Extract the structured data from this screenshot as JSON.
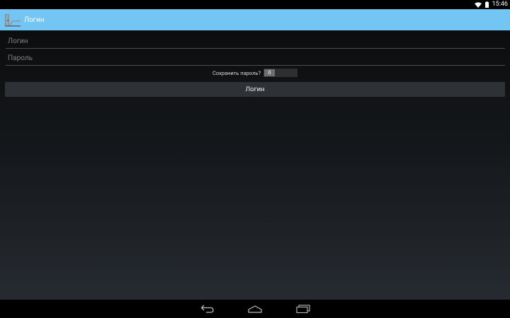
{
  "status_bar": {
    "time": "15:46",
    "icons": [
      "wifi-icon",
      "battery-icon"
    ]
  },
  "action_bar": {
    "title": "Логин",
    "icon": "door-icon",
    "color": "#73c6f3"
  },
  "form": {
    "login_placeholder": "Логин",
    "password_placeholder": "Пароль",
    "save_password_label": "Сохранить пароль?",
    "save_password_toggle_value": "0",
    "login_button_label": "Логин"
  },
  "nav_bar": {
    "icons": [
      "back-icon",
      "home-icon",
      "recents-icon"
    ]
  }
}
